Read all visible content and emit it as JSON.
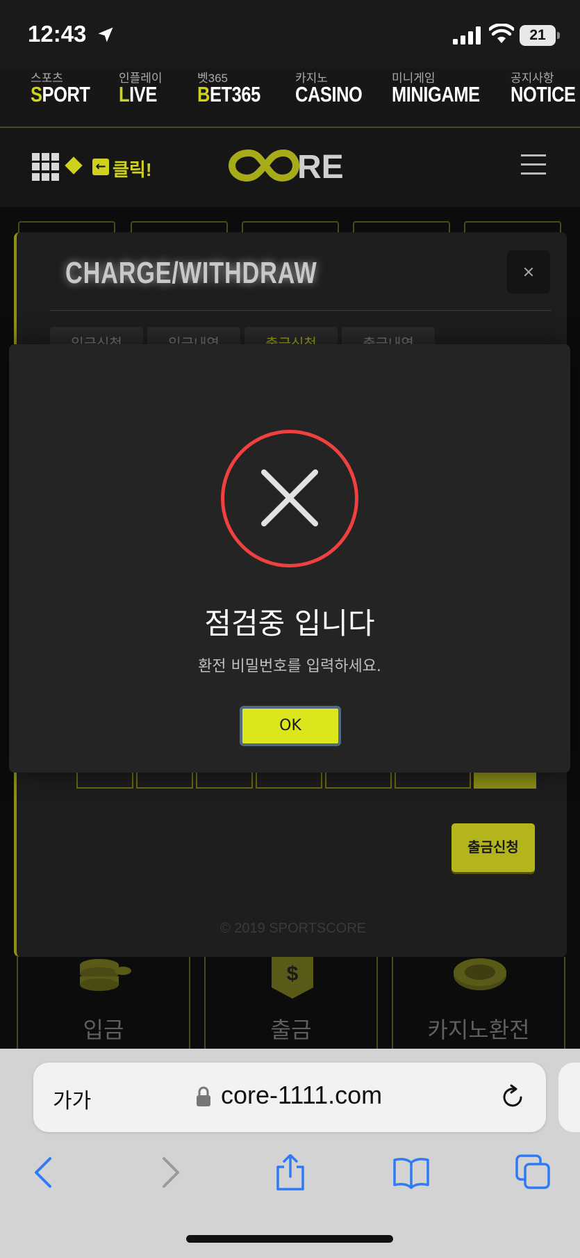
{
  "status_bar": {
    "time": "12:43",
    "battery": "21"
  },
  "top_nav": {
    "items": [
      {
        "sub": "스포츠",
        "accent": "S",
        "rest": "PORT"
      },
      {
        "sub": "인플레이",
        "accent": "L",
        "rest": "IVE"
      },
      {
        "sub": "벳365",
        "accent": "B",
        "rest": "ET365"
      },
      {
        "sub": "카지노",
        "accent": "",
        "rest": "CASINO"
      },
      {
        "sub": "미니게임",
        "accent": "",
        "rest": "MINIGAME"
      },
      {
        "sub": "공지사항",
        "accent": "",
        "rest": "NOTICE"
      }
    ]
  },
  "header": {
    "click_label": "클릭!",
    "logo_text": "CORE"
  },
  "charge_panel": {
    "title": "CHARGE/WITHDRAW",
    "tabs": [
      "입금신청",
      "입금내역",
      "출금신청",
      "출금내역"
    ],
    "withdraw_button": "출금신청",
    "copyright": "© 2019 SPORTSCORE"
  },
  "quick_menu": {
    "items": [
      "입금",
      "출금",
      "카지노환전"
    ]
  },
  "modal": {
    "title": "점검중 입니다",
    "message": "환전 비밀번호를 입력하세요.",
    "ok_label": "OK"
  },
  "browser": {
    "aa_label": "가가",
    "url": "core-1111.com"
  },
  "colors": {
    "accent": "#cfd11f",
    "error": "#f0403f",
    "ok_button": "#dce61c"
  }
}
